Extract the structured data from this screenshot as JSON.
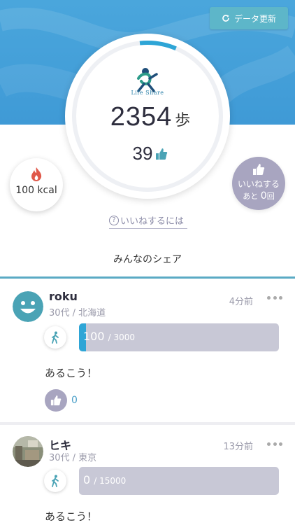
{
  "header": {
    "refresh_label": "データ更新"
  },
  "ring": {
    "logo_text": "Life Share",
    "progress": 0.08
  },
  "stats": {
    "steps": "2354",
    "steps_unit": "歩",
    "likes": "39"
  },
  "kcal": {
    "label": "100 kcal"
  },
  "like_button": {
    "line1": "いいねする",
    "line2_prefix": "あと",
    "remaining": "0",
    "line2_suffix": "回"
  },
  "howto": {
    "label": "いいねするには",
    "q": "?"
  },
  "share_title": "みんなのシェア",
  "posts": [
    {
      "name": "roku",
      "meta": "30代 / 北海道",
      "time": "4分前",
      "steps": "100",
      "goal": "/ 3000",
      "progress": 0.0333,
      "comment": "あるこう！",
      "likes": "0"
    },
    {
      "name": "ヒキ",
      "meta": "30代 / 東京",
      "time": "13分前",
      "steps": "0",
      "goal": "/ 15000",
      "progress": 0,
      "comment": "あるこう！"
    }
  ],
  "colors": {
    "accent": "#2ea5d6",
    "teal": "#4aa3b5",
    "like_bg": "#a8a5c0",
    "header_bg": "#3f9ad6"
  },
  "icons": [
    "refresh-icon",
    "life-share-logo",
    "thumb-up-icon",
    "flame-icon",
    "question-icon",
    "smiley-avatar",
    "photo-avatar",
    "walk-icon",
    "more-icon"
  ]
}
